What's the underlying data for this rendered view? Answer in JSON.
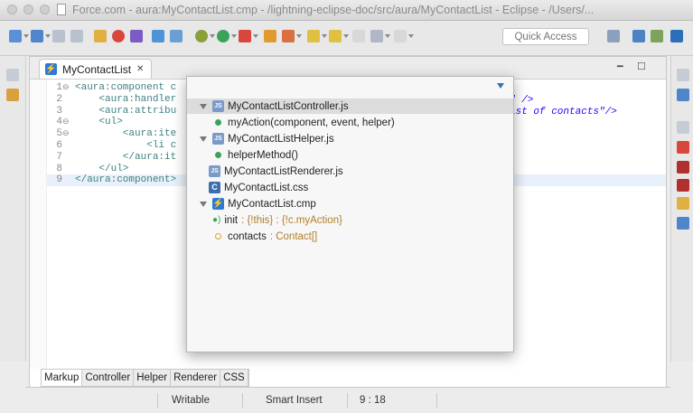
{
  "window": {
    "title": "Force.com - aura:MyContactList.cmp - /lightning-eclipse-doc/src/aura/MyContactList - Eclipse - /Users/..."
  },
  "toolbar": {
    "quick_access_placeholder": "Quick Access"
  },
  "editor": {
    "tab_label": "MyContactList",
    "tab_close": "✕",
    "code_lines": [
      {
        "num": "1",
        "text": "<aura:component c"
      },
      {
        "num": "2",
        "text": "    <aura:handler"
      },
      {
        "num": "3",
        "text": "    <aura:attribu"
      },
      {
        "num": "4",
        "text": "    <ul>"
      },
      {
        "num": "5",
        "text": "        <aura:ite"
      },
      {
        "num": "6",
        "text": "            <li c"
      },
      {
        "num": "7",
        "text": "        </aura:it"
      },
      {
        "num": "8",
        "text": "    </ul>"
      },
      {
        "num": "9",
        "text": "</aura:component>"
      }
    ],
    "right_code": {
      "line2": "\" />",
      "line3": "ist of contacts\"/>"
    },
    "bottom_tabs": [
      "Markup",
      "Controller",
      "Helper",
      "Renderer",
      "CSS"
    ]
  },
  "outline_popup": {
    "items": [
      {
        "label": "MyContactListController.js",
        "type": "js",
        "expanded": true,
        "selected": true
      },
      {
        "label": "myAction(component, event, helper)",
        "type": "method",
        "indent": 1
      },
      {
        "label": "MyContactListHelper.js",
        "type": "js",
        "expanded": true
      },
      {
        "label": "helperMethod()",
        "type": "method",
        "indent": 1
      },
      {
        "label": "MyContactListRenderer.js",
        "type": "js"
      },
      {
        "label": "MyContactList.css",
        "type": "css"
      },
      {
        "label": "MyContactList.cmp",
        "type": "cmp",
        "expanded": true
      },
      {
        "label": "init",
        "suffix": " : {!this} : {!c.myAction}",
        "type": "handler",
        "indent": 1
      },
      {
        "label": "contacts",
        "suffix": " : Contact[]",
        "type": "attribute",
        "indent": 1
      }
    ]
  },
  "statusbar": {
    "writable": "Writable",
    "insert_mode": "Smart Insert",
    "position": "9 : 18"
  }
}
